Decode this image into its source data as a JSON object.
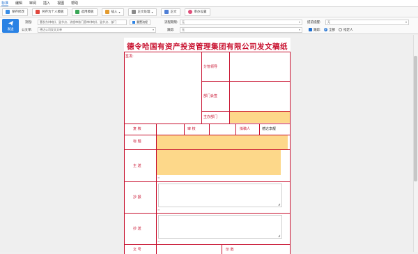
{
  "menu": {
    "items": [
      "标准",
      "编辑",
      "审阅",
      "插入",
      "视图",
      "帮助"
    ]
  },
  "toolbar": {
    "save_label": "保存修改",
    "personal_draft_label": "另存为个人模板",
    "use_template_label": "选用模板",
    "insert_label": "插入",
    "body_label": "正文处理",
    "attach_label": "正文",
    "settings_label": "审办设置",
    "colors": {
      "save": "#3a8ee6",
      "personal": "#e0483e",
      "template": "#3aa757",
      "insert": "#e39b2f",
      "body": "#8a8a8a",
      "attach": "#4f7fd6",
      "settings": "#e04f7a"
    }
  },
  "form": {
    "send_label": "发送",
    "flow_label": "流程:",
    "flow_value": "董发东(审核)、监节点、流程审核门直审(审核)、监节点、部门",
    "flow_button": "重置流程",
    "flow_deadline_label": "流程期限:",
    "flow_deadline_value": "无",
    "remind_label": "提前提醒:",
    "remind_value": "无",
    "doc_type_label": "公文单:",
    "doc_type_value": "德达公司发文文单",
    "tracking_label": "跟踪:",
    "tracking_value": "无",
    "track_check_label": "跟踪:",
    "radio_all": "全部",
    "radio_specific": "指定人"
  },
  "document": {
    "title": "德令哈国有资产投资管理集团有限公司发文稿纸",
    "sign_label": "签发:",
    "leader_label": "分管领导",
    "dept_sign_label": "部门会签",
    "host_dept_label": "主办部门",
    "review_label": "复  核",
    "audit_label": "审  核",
    "drafter_label": "拟稿人",
    "drafter_value": "德达李靓",
    "subject_label": "标  题",
    "main_send_label": "主  送",
    "cc1_label": "抄  报",
    "cc2_label": "抄  送",
    "bottom_left_label": "文  号",
    "bottom_right_label": "印  数"
  },
  "colors": {
    "accent": "#2a82e4",
    "doc_red": "#c8102e",
    "fill_yellow": "#fdd88a"
  }
}
